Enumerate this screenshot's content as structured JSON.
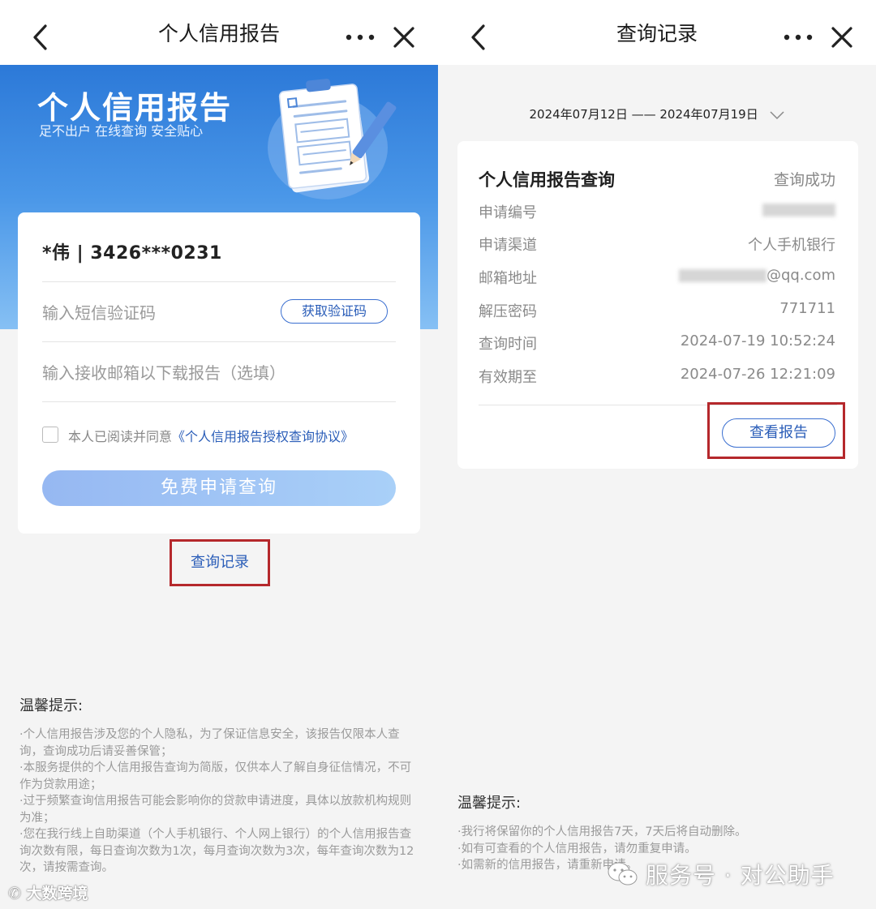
{
  "left": {
    "nav": {
      "title": "个人信用报告"
    },
    "hero": {
      "title": "个人信用报告",
      "subtitle": "足不出户 在线查询 安全贴心"
    },
    "form": {
      "user_id": "*伟 | 3426***0231",
      "sms_placeholder": "输入短信验证码",
      "get_code_label": "获取验证码",
      "email_placeholder": "输入接收邮箱以下载报告（选填）",
      "agree_prefix": "本人已阅读并同意",
      "agree_link": "《个人信用报告授权查询协议》",
      "submit_label": "免费申请查询"
    },
    "record_link": "查询记录",
    "tips": {
      "title": "温馨提示:",
      "lines": [
        "·个人信用报告涉及您的个人隐私，为了保证信息安全，该报告仅限本人查询，查询成功后请妥善保管；",
        "·本服务提供的个人信用报告查询为简版，仅供本人了解自身征信情况，不可作为贷款用途；",
        "·过于频繁查询信用报告可能会影响你的贷款申请进度，具体以放款机构规则为准；",
        "·您在我行线上自助渠道（个人手机银行、个人网上银行）的个人信用报告查询次数有限，每日查询次数为1次，每月查询次数为3次，每年查询次数为12次，请按需查询。"
      ]
    },
    "watermark": "大数跨境"
  },
  "right": {
    "nav": {
      "title": "查询记录"
    },
    "date_range": "2024年07月12日 —— 2024年07月19日",
    "record": {
      "title": "个人信用报告查询",
      "status": "查询成功",
      "rows": [
        {
          "label": "申请编号",
          "value": ""
        },
        {
          "label": "申请渠道",
          "value": "个人手机银行"
        },
        {
          "label": "邮箱地址",
          "value": "@qq.com"
        },
        {
          "label": "解压密码",
          "value": "771711"
        },
        {
          "label": "查询时间",
          "value": "2024-07-19 10:52:24"
        },
        {
          "label": "有效期至",
          "value": "2024-07-26 12:21:09"
        }
      ],
      "view_button": "查看报告"
    },
    "tips": {
      "title": "温馨提示:",
      "lines": [
        "·我行将保留你的个人信用报告7天，7天后将自动删除。",
        "·如有可查看的个人信用报告，请勿重复申请。",
        "·如需新的信用报告，请重新申请。"
      ]
    },
    "watermark": "服务号 · 对公助手"
  },
  "colors": {
    "accent_blue": "#2a5db8",
    "highlight_red": "#b5282c",
    "hero_blue": "#2c79d8"
  },
  "icons": [
    "back-arrow-icon",
    "more-icon",
    "close-icon",
    "clipboard-illustration",
    "chevron-down-icon",
    "wechat-icon"
  ]
}
